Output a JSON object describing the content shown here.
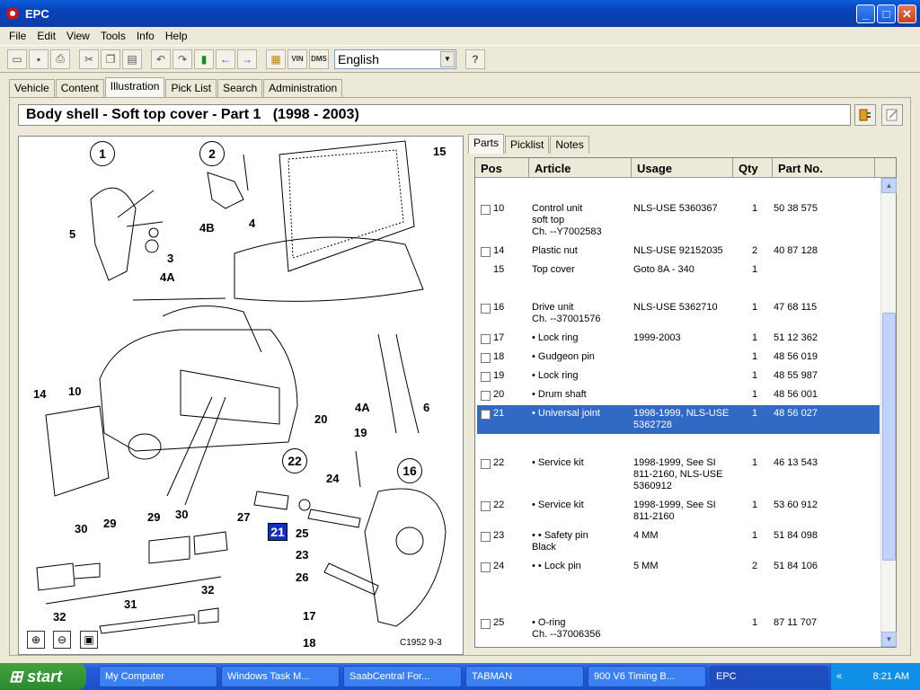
{
  "window": {
    "title": "EPC"
  },
  "menu": [
    "File",
    "Edit",
    "View",
    "Tools",
    "Info",
    "Help"
  ],
  "toolbar": {
    "language": "English",
    "vin_label": "VIN",
    "dms_label": "DMS"
  },
  "tabs": [
    "Vehicle",
    "Content",
    "Illustration",
    "Pick List",
    "Search",
    "Administration"
  ],
  "header": {
    "title": "Body shell - Soft top cover - Part 1   (1998 - 2003)"
  },
  "illustration": {
    "caption": "C1952 9-3",
    "callouts": [
      "1",
      "2",
      "15",
      "4B",
      "4",
      "5",
      "3",
      "4A",
      "14",
      "10",
      "4A",
      "6",
      "20",
      "19",
      "22",
      "16",
      "24",
      "27",
      "21",
      "25",
      "23",
      "26",
      "30",
      "29",
      "29",
      "30",
      "31",
      "32",
      "32",
      "17",
      "18"
    ],
    "highlighted": "21"
  },
  "panel_tabs": [
    "Parts",
    "Picklist",
    "Notes"
  ],
  "columns": [
    "Pos",
    "Article",
    "Usage",
    "Qty",
    "Part No."
  ],
  "rows": [
    {
      "pos": "10",
      "article": "Control unit",
      "article2": "soft top",
      "article3": "Ch. --Y7002583",
      "usage": "NLS-USE 5360367",
      "usage2": "",
      "usage3": "",
      "qty": "1",
      "part": "50 38 575",
      "checkbox": true
    },
    {
      "pos": "14",
      "article": "Plastic nut",
      "article2": "",
      "article3": "",
      "usage": "NLS-USE 92152035",
      "usage2": "",
      "usage3": "",
      "qty": "2",
      "part": "40 87 128",
      "checkbox": true
    },
    {
      "pos": "15",
      "article": "Top cover",
      "article2": "",
      "article3": "",
      "usage": "Goto 8A - 340",
      "usage2": "",
      "usage3": "",
      "qty": "1",
      "part": "",
      "checkbox": false
    },
    {
      "pos": "16",
      "article": "Drive unit",
      "article2": "Ch. --37001576",
      "article3": "",
      "usage": "NLS-USE 5362710",
      "usage2": "",
      "usage3": "",
      "qty": "1",
      "part": "47 68 115",
      "checkbox": true
    },
    {
      "pos": "17",
      "article": "• Lock ring",
      "article2": "",
      "article3": "",
      "usage": "1999-2003",
      "usage2": "",
      "usage3": "",
      "qty": "1",
      "part": "51 12 362",
      "checkbox": true
    },
    {
      "pos": "18",
      "article": "• Gudgeon pin",
      "article2": "",
      "article3": "",
      "usage": "",
      "usage2": "",
      "usage3": "",
      "qty": "1",
      "part": "48 56 019",
      "checkbox": true
    },
    {
      "pos": "19",
      "article": "• Lock ring",
      "article2": "",
      "article3": "",
      "usage": "",
      "usage2": "",
      "usage3": "",
      "qty": "1",
      "part": "48 55 987",
      "checkbox": true
    },
    {
      "pos": "20",
      "article": "• Drum shaft",
      "article2": "",
      "article3": "",
      "usage": "",
      "usage2": "",
      "usage3": "",
      "qty": "1",
      "part": "48 56 001",
      "checkbox": true
    },
    {
      "pos": "21",
      "article": "• Universal joint",
      "article2": "",
      "article3": "",
      "usage": "1998-1999, NLS-USE",
      "usage2": "5362728",
      "usage3": "",
      "qty": "1",
      "part": "48 56 027",
      "checkbox": true,
      "selected": true
    },
    {
      "pos": "22",
      "article": "• Service kit",
      "article2": "",
      "article3": "",
      "usage": "1998-1999, See SI",
      "usage2": "811-2160, NLS-USE",
      "usage3": "5360912",
      "qty": "1",
      "part": "46 13 543",
      "checkbox": true
    },
    {
      "pos": "22",
      "article": "• Service kit",
      "article2": "",
      "article3": "",
      "usage": "1998-1999, See SI",
      "usage2": "811-2160",
      "usage3": "",
      "qty": "1",
      "part": "53 60 912",
      "checkbox": true
    },
    {
      "pos": "23",
      "article": "• • Safety pin",
      "article2": "Black",
      "article3": "",
      "usage": "4 MM",
      "usage2": "",
      "usage3": "",
      "qty": "1",
      "part": "51 84 098",
      "checkbox": true
    },
    {
      "pos": "24",
      "article": "• • Lock pin",
      "article2": "",
      "article3": "",
      "usage": "5 MM",
      "usage2": "",
      "usage3": "",
      "qty": "2",
      "part": "51 84 106",
      "checkbox": true
    },
    {
      "pos": "25",
      "article": "• O-ring",
      "article2": "Ch. --37006356",
      "article3": "",
      "usage": "",
      "usage2": "",
      "usage3": "",
      "qty": "1",
      "part": "87 11 707",
      "checkbox": true
    }
  ],
  "taskbar": {
    "start": "start",
    "tasks": [
      "My Computer",
      "Windows Task M...",
      "SaabCentral For...",
      "TABMAN",
      "900 V6 Timing B...",
      "EPC"
    ],
    "clock": "8:21 AM"
  }
}
